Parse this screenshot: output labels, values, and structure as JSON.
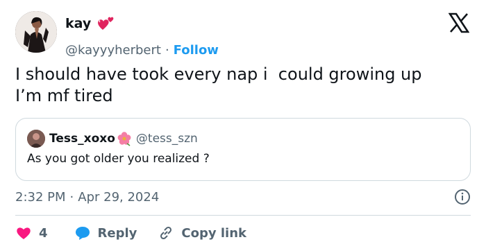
{
  "author": {
    "display_name": "kay",
    "handle": "@kayyyherbert",
    "separator": "·",
    "follow_label": "Follow"
  },
  "tweet": {
    "text": "I should have took every nap i  could growing up\nI’m mf tired"
  },
  "quoted": {
    "display_name": "Tess_xoxo",
    "handle": "@tess_szn",
    "text": "As you got older you realized ?"
  },
  "meta": {
    "time": "2:32 PM",
    "separator": "·",
    "date": "Apr 29, 2024"
  },
  "actions": {
    "like_count": "4",
    "reply_label": "Reply",
    "copy_label": "Copy link"
  },
  "colors": {
    "accent": "#1d9bf0",
    "like": "#f91880",
    "text": "#0f1419",
    "secondary": "#536471",
    "border": "#cfd9de"
  },
  "icons": {
    "author_badge": "two-hearts-icon",
    "platform": "x-logo-icon",
    "quoted_badge": "hibiscus-icon",
    "info": "info-icon",
    "like": "heart-icon",
    "reply": "speech-bubble-icon",
    "copy": "link-icon"
  }
}
